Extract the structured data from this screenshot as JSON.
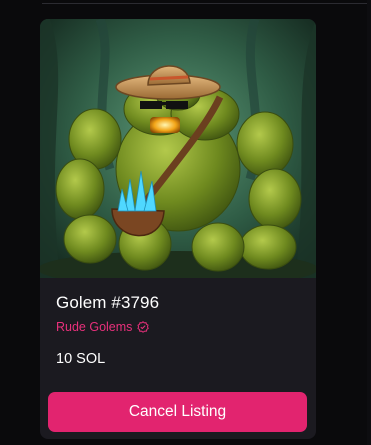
{
  "nft": {
    "name": "Golem #3796",
    "collection": "Rude Golems",
    "price": "10 SOL",
    "image_subject": "golem-artwork"
  },
  "actions": {
    "cancel_label": "Cancel Listing"
  },
  "colors": {
    "page_bg": "#0a0a0c",
    "card_bg": "#1b1a20",
    "accent": "#e2246f",
    "collection_text": "#e8307b"
  },
  "icons": {
    "verified": "verified-badge-icon"
  }
}
